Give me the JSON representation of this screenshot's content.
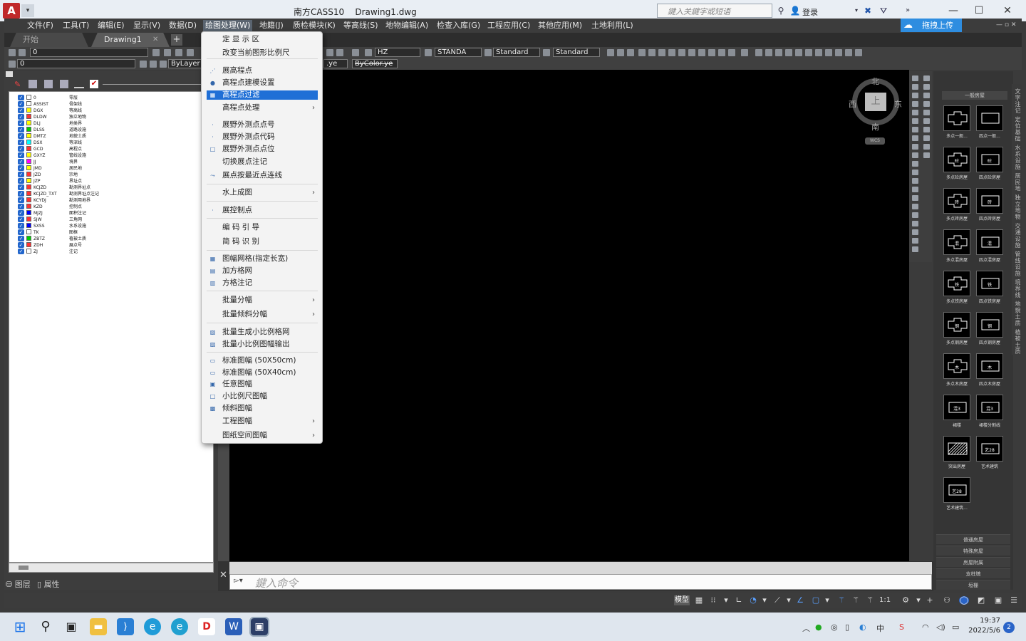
{
  "window": {
    "app_name": "南方CASS10",
    "file_name": "Drawing1.dwg",
    "search_placeholder": "鍵入关鍵字或短语",
    "login_label": "登录"
  },
  "menubar": {
    "items": [
      "文件(F)",
      "工具(T)",
      "编辑(E)",
      "显示(V)",
      "数据(D)",
      "绘图处理(W)",
      "地籍(J)",
      "质检模块(K)",
      "等高线(S)",
      "地物编辑(A)",
      "检查入库(G)",
      "工程应用(C)",
      "其他应用(M)",
      "土地利用(L)"
    ],
    "active": "绘图处理(W)",
    "cloud_upload_label": "拖拽上传"
  },
  "tabs": {
    "start": "开始",
    "drawing": "Drawing1"
  },
  "toolbar": {
    "layer_combo": "0",
    "layer_combo2": "0",
    "bylayer": "ByLayer",
    "text_style": "HZ",
    "dim_style": "STANDA",
    "table_style": "Standard",
    "multileader_style": "Standard",
    "linetype_partial": ".ye",
    "bycolor": "ByColor.ye"
  },
  "layer_panel": {
    "layers": [
      {
        "name": "0",
        "desc": "零层",
        "color": "#ffffff"
      },
      {
        "name": "ASSIST",
        "desc": "骨架线",
        "color": "#ffffff"
      },
      {
        "name": "DGX",
        "desc": "等高线",
        "color": "#ffff00"
      },
      {
        "name": "DLDW",
        "desc": "独立地物",
        "color": "#ff3333"
      },
      {
        "name": "DLJ",
        "desc": "地类界",
        "color": "#ffff00"
      },
      {
        "name": "DLSS",
        "desc": "道路设施",
        "color": "#00cc00"
      },
      {
        "name": "DMTZ",
        "desc": "地貌土质",
        "color": "#ffff00"
      },
      {
        "name": "DSX",
        "desc": "等深线",
        "color": "#00ffff"
      },
      {
        "name": "GCD",
        "desc": "高程点",
        "color": "#ff3333"
      },
      {
        "name": "GXYZ",
        "desc": "管线设施",
        "color": "#ffff00"
      },
      {
        "name": "JJ",
        "desc": "境界",
        "color": "#ff00ff"
      },
      {
        "name": "JMD",
        "desc": "居民地",
        "color": "#ffff00"
      },
      {
        "name": "JZD",
        "desc": "宗地",
        "color": "#ff3333"
      },
      {
        "name": "JZP",
        "desc": "界址点",
        "color": "#ffff00"
      },
      {
        "name": "KCJZD",
        "desc": "勘测界址点",
        "color": "#ff3333"
      },
      {
        "name": "KCJZD_TXT",
        "desc": "勘测界址点注记",
        "color": "#ff3333"
      },
      {
        "name": "KCYDJ",
        "desc": "勘测用地界",
        "color": "#ff3333"
      },
      {
        "name": "KZD",
        "desc": "控制点",
        "color": "#ff3333"
      },
      {
        "name": "MJZJ",
        "desc": "面积注记",
        "color": "#0000ff"
      },
      {
        "name": "SJW",
        "desc": "三角网",
        "color": "#ff3333"
      },
      {
        "name": "SXSS",
        "desc": "水系设施",
        "color": "#0000ff"
      },
      {
        "name": "TK",
        "desc": "图框",
        "color": "#ffffff"
      },
      {
        "name": "ZBTZ",
        "desc": "植被土质",
        "color": "#00cc00"
      },
      {
        "name": "ZDH",
        "desc": "展点号",
        "color": "#ff3333"
      },
      {
        "name": "ZJ",
        "desc": "注记",
        "color": "#ffffff"
      }
    ],
    "footer_layers": "图层",
    "footer_props": "属性"
  },
  "viewcube": {
    "north": "北",
    "south": "南",
    "east": "东",
    "west": "西",
    "top": "上",
    "wcs": "WCS"
  },
  "command_line": {
    "placeholder": "鍵入命令"
  },
  "palette": {
    "title": "一般房屋",
    "items": [
      {
        "label": "多点一般...",
        "glyph": ""
      },
      {
        "label": "四点一般...",
        "glyph": ""
      },
      {
        "label": "多点砼房屋",
        "glyph": "砼"
      },
      {
        "label": "四点砼房屋",
        "glyph": "砼"
      },
      {
        "label": "多点砖房屋",
        "glyph": "砖"
      },
      {
        "label": "四点砖房屋",
        "glyph": "砖"
      },
      {
        "label": "多点混房屋",
        "glyph": "混"
      },
      {
        "label": "四点混房屋",
        "glyph": "混"
      },
      {
        "label": "多点铁房屋",
        "glyph": "铁"
      },
      {
        "label": "四点铁房屋",
        "glyph": "铁"
      },
      {
        "label": "多点钢房屋",
        "glyph": "钢"
      },
      {
        "label": "四点钢房屋",
        "glyph": "钢"
      },
      {
        "label": "多点木房屋",
        "glyph": "木"
      },
      {
        "label": "四点木房屋",
        "glyph": "木"
      },
      {
        "label": "裙楼",
        "glyph": "混3"
      },
      {
        "label": "裙楼分割线",
        "glyph": "混3"
      },
      {
        "label": "突出房屋",
        "glyph": ""
      },
      {
        "label": "艺术建筑",
        "glyph": "艺28"
      },
      {
        "label": "艺术建筑...",
        "glyph": "艺28"
      }
    ],
    "categories": [
      "普通房屋",
      "特殊房屋",
      "房屋附属",
      "支柱墩",
      "垣栅"
    ],
    "side_tabs": "文字注记 定位基础 水系设施 居民地 独立地物 交通设施 管线设施 境界线 地貌土质 植被土质"
  },
  "statusbar": {
    "model": "模型",
    "scale": "1:1"
  },
  "dropdown": {
    "items": [
      {
        "label": "定 显 示 区",
        "icon": "",
        "submenu": false
      },
      {
        "label": "改变当前图形比例尺",
        "icon": "",
        "submenu": false
      },
      {
        "label": "展高程点",
        "icon": "⋰",
        "submenu": false
      },
      {
        "label": "高程点建模设置",
        "icon": "●",
        "submenu": false
      },
      {
        "label": "高程点过滤",
        "icon": "▦",
        "submenu": false
      },
      {
        "label": "高程点处理",
        "icon": "",
        "submenu": true
      },
      {
        "label": "展野外测点点号",
        "icon": "·",
        "submenu": false
      },
      {
        "label": "展野外测点代码",
        "icon": "·",
        "submenu": false
      },
      {
        "label": "展野外测点点位",
        "icon": "□",
        "submenu": false
      },
      {
        "label": "切换展点注记",
        "icon": "",
        "submenu": false
      },
      {
        "label": "展点按最近点连线",
        "icon": "⤳",
        "submenu": false
      },
      {
        "label": "水上成图",
        "icon": "",
        "submenu": true
      },
      {
        "label": "展控制点",
        "icon": "·",
        "submenu": false
      },
      {
        "label": "编 码 引 导",
        "icon": "",
        "submenu": false
      },
      {
        "label": "简 码 识 别",
        "icon": "",
        "submenu": false
      },
      {
        "label": "图幅网格(指定长宽)",
        "icon": "▦",
        "submenu": false
      },
      {
        "label": "加方格网",
        "icon": "▤",
        "submenu": false
      },
      {
        "label": "方格注记",
        "icon": "▥",
        "submenu": false
      },
      {
        "label": "批量分幅",
        "icon": "",
        "submenu": true
      },
      {
        "label": "批量倾斜分幅",
        "icon": "",
        "submenu": true
      },
      {
        "label": "批量生成小比例格网",
        "icon": "▧",
        "submenu": false
      },
      {
        "label": "批量小比例图幅输出",
        "icon": "▨",
        "submenu": false
      },
      {
        "label": "标准图幅 (50X50cm)",
        "icon": "▭",
        "submenu": false
      },
      {
        "label": "标准图幅 (50X40cm)",
        "icon": "▭",
        "submenu": false
      },
      {
        "label": "任意图幅",
        "icon": "▣",
        "submenu": false
      },
      {
        "label": "小比例尺图幅",
        "icon": "□",
        "submenu": false
      },
      {
        "label": "倾斜图幅",
        "icon": "▩",
        "submenu": false
      },
      {
        "label": "工程图幅",
        "icon": "",
        "submenu": true
      },
      {
        "label": "图纸空间图幅",
        "icon": "",
        "submenu": true
      }
    ],
    "highlighted": "高程点过滤"
  },
  "taskbar": {
    "time": "19:37",
    "date": "2022/5/6",
    "notifications": "2",
    "ime": "中"
  }
}
